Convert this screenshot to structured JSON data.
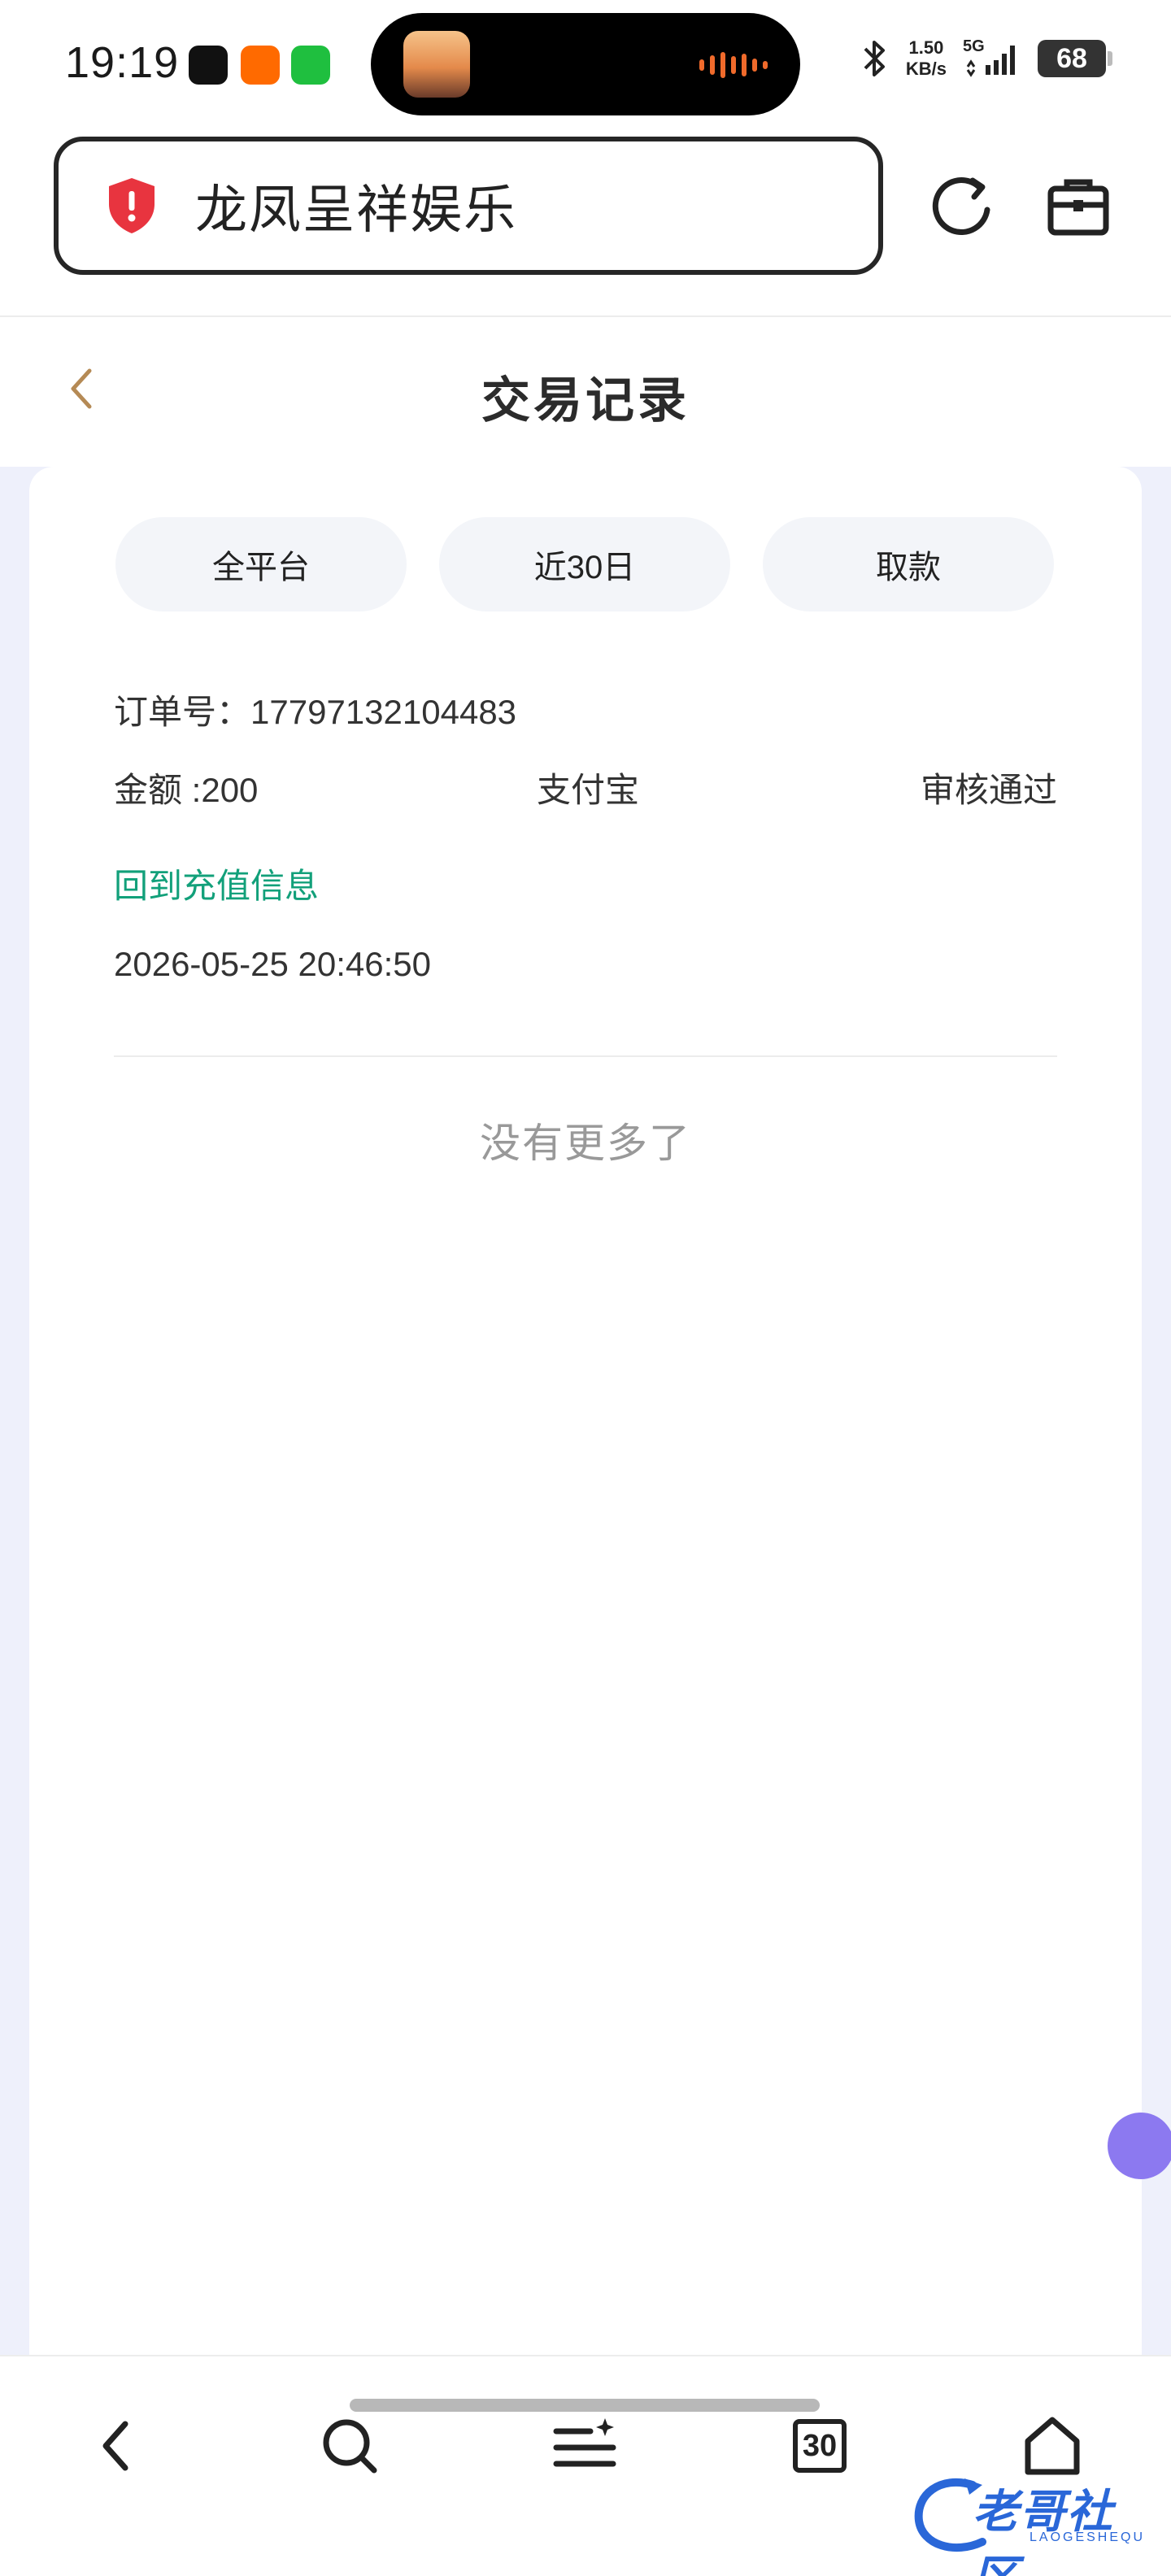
{
  "status_bar": {
    "time": "19:19",
    "net_speed_value": "1.50",
    "net_speed_unit": "KB/s",
    "network": "5G",
    "battery": "68"
  },
  "browser": {
    "site_title": "龙凤呈祥娱乐"
  },
  "header": {
    "title": "交易记录"
  },
  "filters": [
    {
      "label": "全平台"
    },
    {
      "label": "近30日"
    },
    {
      "label": "取款"
    }
  ],
  "record": {
    "order_label": "订单号：",
    "order_no": "17797132104483",
    "amount": "金额 :200",
    "method": "支付宝",
    "status": "审核通过",
    "link": "回到充值信息",
    "time": "2026-05-25 20:46:50"
  },
  "list_end": "没有更多了",
  "bottom_nav": {
    "tab_count": "30"
  },
  "watermark": {
    "text": "老哥社区",
    "sub": "LAOGESHEQU"
  },
  "colors": {
    "accent_green": "#12a07a",
    "content_bg": "#eef0fb",
    "shield_red": "#e8343f",
    "back_arrow": "#b58a55"
  }
}
